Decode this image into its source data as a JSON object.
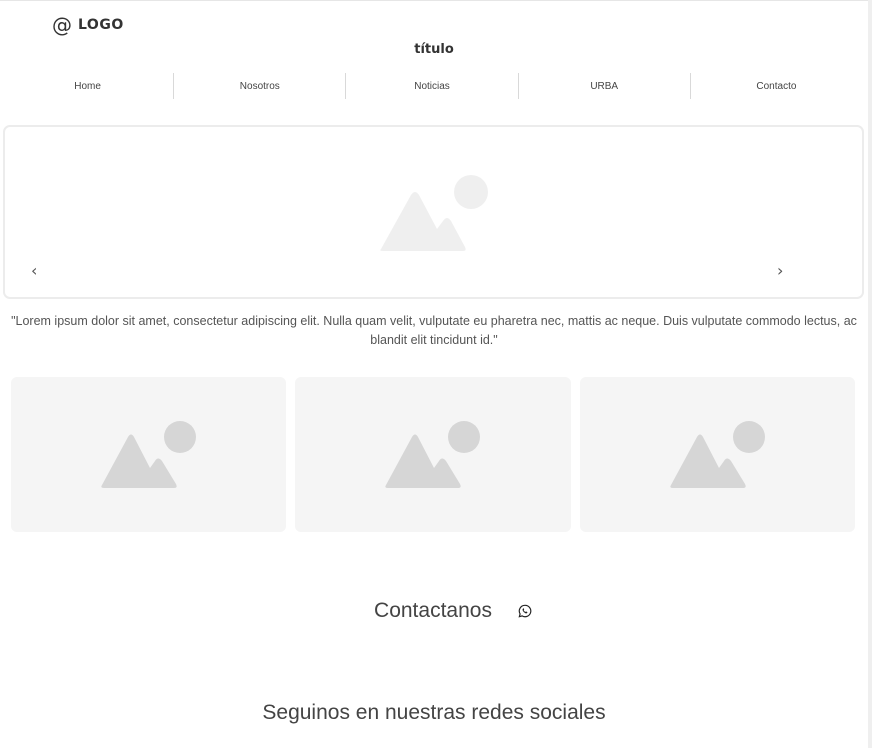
{
  "header": {
    "logo_icon": "@",
    "logo_text": "LOGO",
    "title": "título"
  },
  "nav": {
    "items": [
      {
        "label": "Home"
      },
      {
        "label": "Nosotros"
      },
      {
        "label": "Noticias"
      },
      {
        "label": "URBA"
      },
      {
        "label": "Contacto"
      }
    ]
  },
  "carousel": {
    "image_icon": "image-placeholder-icon",
    "prev_glyph": "‹",
    "next_glyph": "›"
  },
  "quote": {
    "text": "\"Lorem ipsum dolor sit amet, consectetur adipiscing elit. Nulla quam velit, vulputate eu pharetra nec, mattis ac neque. Duis vulputate commodo lectus, ac blandit elit tincidunt id.\""
  },
  "cards": [
    {
      "icon": "image-placeholder-icon"
    },
    {
      "icon": "image-placeholder-icon"
    },
    {
      "icon": "image-placeholder-icon"
    }
  ],
  "contact": {
    "label": "Contactanos",
    "icon": "whatsapp-icon"
  },
  "social": {
    "label": "Seguinos en nuestras redes sociales"
  },
  "colors": {
    "placeholder_light": "#efefef",
    "placeholder_card": "#d6d6d6",
    "card_bg": "#f5f5f5",
    "text": "#444444"
  }
}
